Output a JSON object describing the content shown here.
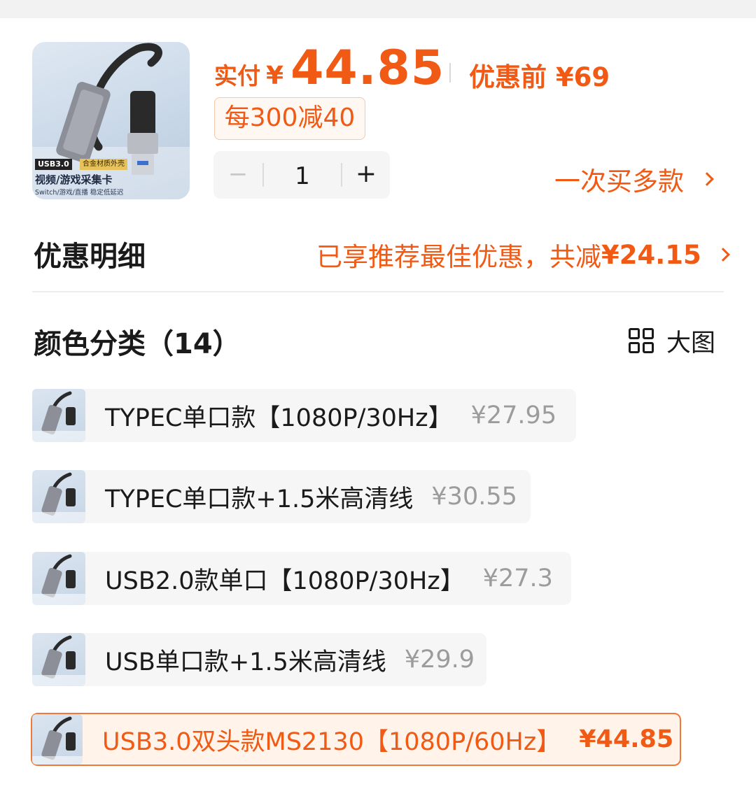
{
  "product": {
    "thumb_tag": "USB3.0",
    "thumb_tag2": "合金材质外壳",
    "thumb_title": "视频/游戏采集卡",
    "thumb_sub": "Switch/游戏/直播 稳定低延迟",
    "price_prefix": "实付",
    "currency": "¥",
    "price": "44.85",
    "original_price": "优惠前 ¥69",
    "promo": "每300减40",
    "quantity": "1",
    "minus_label": "−",
    "plus_label": "+",
    "multi_buy": "一次买多款",
    "accent_color": "#f05a14"
  },
  "discount": {
    "title": "优惠明细",
    "summary": "已享推荐最佳优惠，共减",
    "amount": "¥24.15"
  },
  "variants_section": {
    "title": "颜色分类（14）",
    "big_view": "大图"
  },
  "variants": [
    {
      "label": "TYPEC单口款【1080P/30Hz】",
      "price": "¥27.95",
      "selected": false
    },
    {
      "label": "TYPEC单口款+1.5米高清线",
      "price": "¥30.55",
      "selected": false
    },
    {
      "label": "USB2.0款单口【1080P/30Hz】",
      "price": "¥27.3",
      "selected": false
    },
    {
      "label": "USB单口款+1.5米高清线",
      "price": "¥29.9",
      "selected": false
    },
    {
      "label": "USB3.0双头款MS2130【1080P/60Hz】",
      "price": "¥44.85",
      "selected": true
    }
  ]
}
